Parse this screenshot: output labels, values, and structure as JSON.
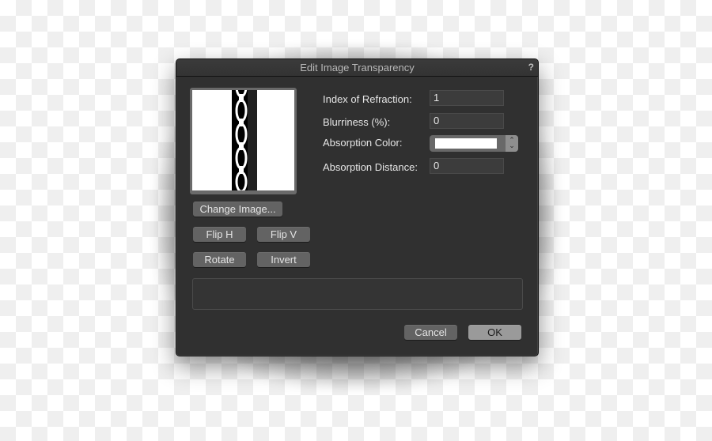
{
  "dialog": {
    "title": "Edit Image Transparency",
    "help_icon": "?"
  },
  "preview": {
    "image_description": "chain-texture"
  },
  "image_buttons": {
    "change_image": "Change Image...",
    "flip_h": "Flip H",
    "flip_v": "Flip V",
    "rotate": "Rotate",
    "invert": "Invert"
  },
  "fields": {
    "index_of_refraction": {
      "label": "Index of Refraction:",
      "value": "1"
    },
    "blurriness": {
      "label": "Blurriness (%):",
      "value": "0"
    },
    "absorption_color": {
      "label": "Absorption Color:",
      "value": "#ffffff"
    },
    "absorption_distance": {
      "label": "Absorption Distance:",
      "value": "0"
    }
  },
  "footer": {
    "cancel": "Cancel",
    "ok": "OK"
  }
}
